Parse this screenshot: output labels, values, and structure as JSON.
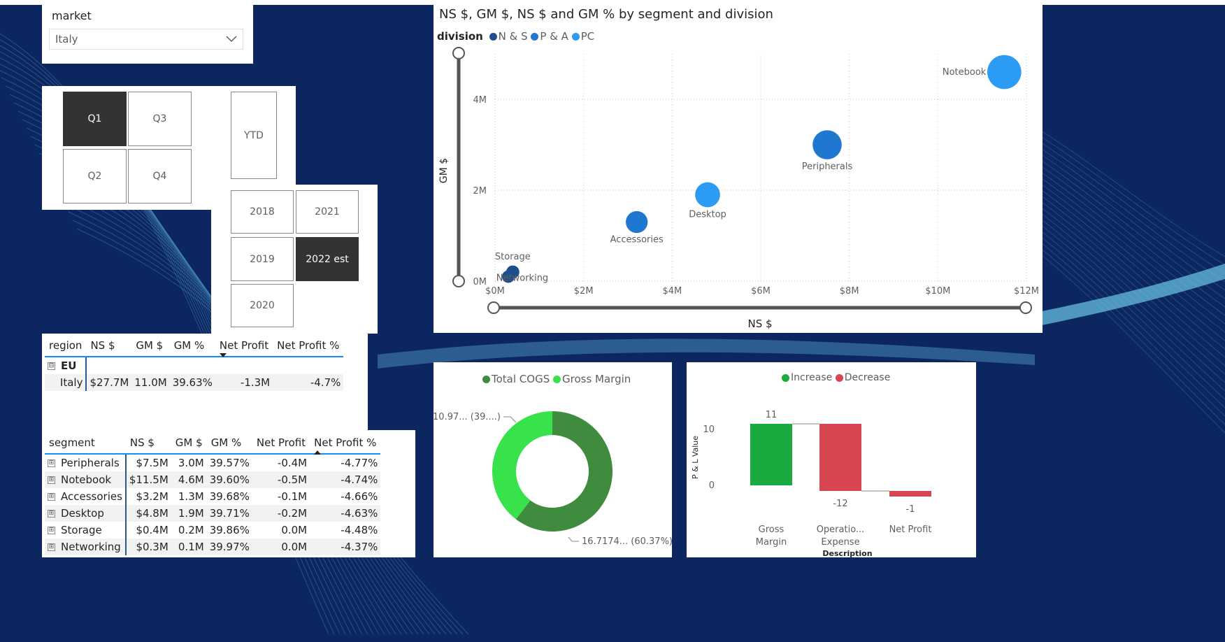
{
  "market_slicer": {
    "title": "market",
    "selected": "Italy"
  },
  "quarters": [
    {
      "label": "Q1",
      "selected": true
    },
    {
      "label": "Q3",
      "selected": false
    },
    {
      "label": "Q2",
      "selected": false
    },
    {
      "label": "Q4",
      "selected": false
    }
  ],
  "ytd": {
    "label": "YTD",
    "selected": false
  },
  "years": [
    {
      "label": "2018",
      "selected": false
    },
    {
      "label": "2021",
      "selected": false
    },
    {
      "label": "2019",
      "selected": false
    },
    {
      "label": "2022 est",
      "selected": true
    },
    {
      "label": "2020",
      "selected": false
    }
  ],
  "region_table": {
    "headers": [
      "region",
      "NS $",
      "GM $",
      "GM %",
      "Net Profit",
      "Net Profit %"
    ],
    "sorted_column": "Net Profit",
    "group": {
      "expander": "⊟",
      "name": "EU"
    },
    "rows": [
      [
        "Italy",
        "$27.7M",
        "11.0M",
        "39.63%",
        "-1.3M",
        "-4.7%"
      ]
    ]
  },
  "segment_table": {
    "headers": [
      "segment",
      "NS $",
      "GM $",
      "GM %",
      "Net Profit",
      "Net Profit %"
    ],
    "sorted_column": "Net Profit %",
    "expander": "⊞",
    "rows": [
      [
        "Peripherals",
        "$7.5M",
        "3.0M",
        "39.57%",
        "-0.4M",
        "-4.77%"
      ],
      [
        "Notebook",
        "$11.5M",
        "4.6M",
        "39.60%",
        "-0.5M",
        "-4.74%"
      ],
      [
        "Accessories",
        "$3.2M",
        "1.3M",
        "39.68%",
        "-0.1M",
        "-4.66%"
      ],
      [
        "Desktop",
        "$4.8M",
        "1.9M",
        "39.71%",
        "-0.2M",
        "-4.63%"
      ],
      [
        "Storage",
        "$0.4M",
        "0.2M",
        "39.86%",
        "0.0M",
        "-4.48%"
      ],
      [
        "Networking",
        "$0.3M",
        "0.1M",
        "39.97%",
        "0.0M",
        "-4.37%"
      ]
    ]
  },
  "chart_data": [
    {
      "type": "scatter",
      "title": "NS $, GM $, NS $ and GM % by segment and division",
      "legend_title": "division",
      "legend": [
        {
          "name": "N & S",
          "color": "#1e4e8c"
        },
        {
          "name": "P & A",
          "color": "#1f77d0"
        },
        {
          "name": "PC",
          "color": "#2b9bf4"
        }
      ],
      "xlabel": "NS $",
      "ylabel": "GM $",
      "xlim": [
        0,
        12
      ],
      "ylim": [
        0,
        5
      ],
      "xticks": [
        "$0M",
        "$2M",
        "$4M",
        "$6M",
        "$8M",
        "$10M",
        "$12M"
      ],
      "yticks": [
        "0M",
        "2M",
        "4M"
      ],
      "points": [
        {
          "label": "Notebook",
          "division": "PC",
          "x": 11.5,
          "y": 4.6
        },
        {
          "label": "Peripherals",
          "division": "P & A",
          "x": 7.5,
          "y": 3.0
        },
        {
          "label": "Desktop",
          "division": "PC",
          "x": 4.8,
          "y": 1.9
        },
        {
          "label": "Accessories",
          "division": "P & A",
          "x": 3.2,
          "y": 1.3
        },
        {
          "label": "Storage",
          "division": "N & S",
          "x": 0.4,
          "y": 0.2
        },
        {
          "label": "Networking",
          "division": "N & S",
          "x": 0.3,
          "y": 0.1
        }
      ],
      "grid": true
    },
    {
      "type": "pie",
      "legend": [
        {
          "name": "Total COGS",
          "color": "#3f8c3f"
        },
        {
          "name": "Gross Margin",
          "color": "#37e24b"
        }
      ],
      "slices": [
        {
          "name": "Total COGS",
          "value": 16.7174,
          "percent": 60.37,
          "label": "16.7174... (60.37%)"
        },
        {
          "name": "Gross Margin",
          "value": 10.97,
          "percent": 39.63,
          "label": "10.97... (39....)"
        }
      ]
    },
    {
      "type": "bar",
      "subtype": "waterfall",
      "legend": [
        {
          "name": "Increase",
          "color": "#1aab40"
        },
        {
          "name": "Decrease",
          "color": "#d64550"
        }
      ],
      "ylabel": "P & L Value",
      "xlabel": "Description",
      "yticks": [
        "10",
        "0"
      ],
      "categories": [
        "Gross Margin",
        "Operatio... Expense",
        "Net Profit"
      ],
      "category_lines": [
        [
          "Gross",
          "Margin"
        ],
        [
          "Operatio...",
          "Expense"
        ],
        [
          "Net Profit"
        ]
      ],
      "values": [
        11,
        -12,
        -1
      ],
      "value_labels": [
        "11",
        "-12",
        "-1"
      ]
    }
  ]
}
